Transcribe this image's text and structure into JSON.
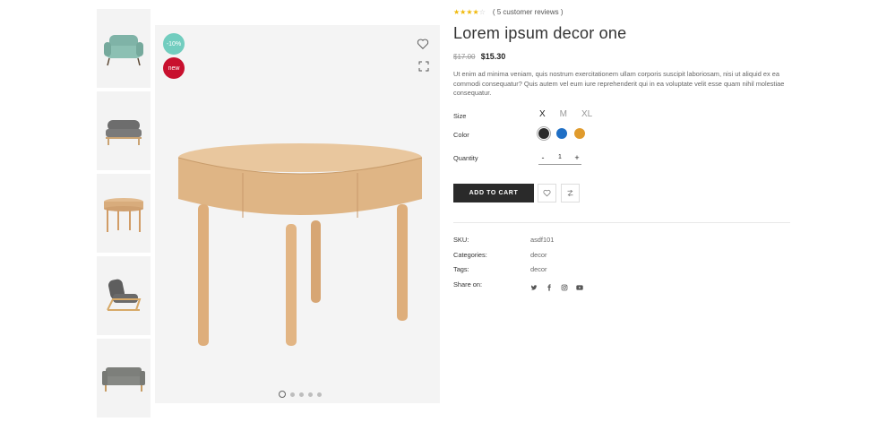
{
  "gallery": {
    "thumbnails": [
      {
        "name": "armchair-teal"
      },
      {
        "name": "bench-grey"
      },
      {
        "name": "round-table"
      },
      {
        "name": "lounge-chair"
      },
      {
        "name": "sofa-grey"
      }
    ],
    "badges": {
      "sale": "-10%",
      "new": "new"
    },
    "active_slide": 1,
    "slide_count": 5
  },
  "product": {
    "rating": {
      "stars": 4,
      "max": 5,
      "reviews_text": "( 5 customer reviews )"
    },
    "title": "Lorem ipsum decor one",
    "price_old": "$17.00",
    "price_new": "$15.30",
    "description": "Ut enim ad minima veniam, quis nostrum exercitationem ullam corporis suscipit laboriosam, nisi ut aliquid ex ea commodi consequatur? Quis autem vel eum iure reprehenderit qui in ea voluptate velit esse quam nihil molestiae consequatur.",
    "size_label": "Size",
    "sizes": [
      "X",
      "M",
      "XL"
    ],
    "selected_size": "X",
    "color_label": "Color",
    "colors": [
      "#2b2b2b",
      "#1f6fc5",
      "#e09b2d"
    ],
    "quantity_label": "Quantity",
    "quantity": "1",
    "qty_minus": "-",
    "qty_plus": "+",
    "add_to_cart": "ADD TO CART"
  },
  "meta": {
    "sku_label": "SKU:",
    "sku": "asdf101",
    "categories_label": "Categories:",
    "categories": "decor",
    "tags_label": "Tags:",
    "tags": "decor",
    "share_label": "Share on:",
    "share_icons": [
      "twitter-icon",
      "facebook-icon",
      "instagram-icon",
      "youtube-icon"
    ]
  }
}
